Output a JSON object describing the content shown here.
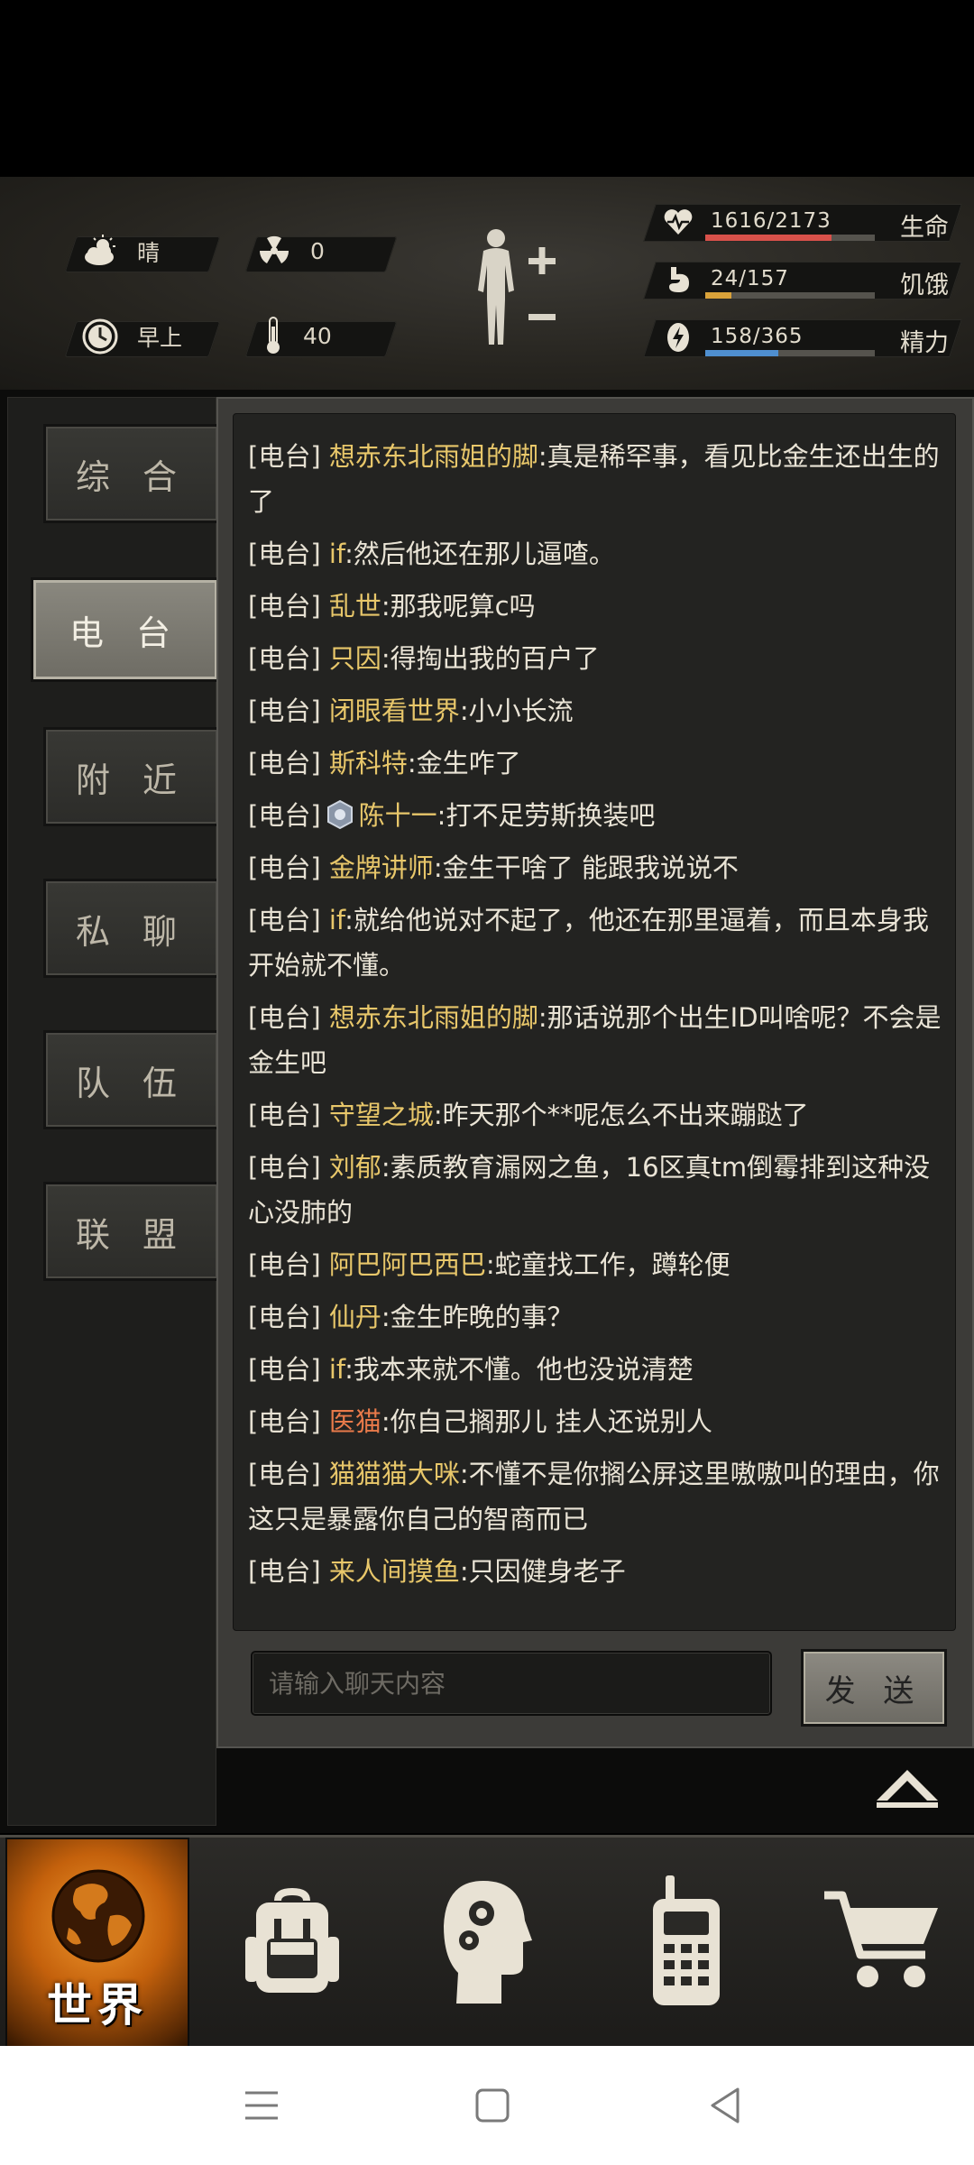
{
  "status": {
    "weather": "晴",
    "radiation": "0",
    "time_of_day": "早上",
    "temperature": "40",
    "stats": [
      {
        "label": "生命",
        "value": "1616/2173",
        "current": 1616,
        "max": 2173,
        "color": "#d8514a",
        "icon": "heart-icon"
      },
      {
        "label": "饥饿",
        "value": "24/157",
        "current": 24,
        "max": 157,
        "color": "#d9a23a",
        "icon": "stomach-icon"
      },
      {
        "label": "精力",
        "value": "158/365",
        "current": 158,
        "max": 365,
        "color": "#4f8fd0",
        "icon": "energy-icon"
      }
    ]
  },
  "tabs": [
    "综 合",
    "电 台",
    "附 近",
    "私 聊",
    "队 伍",
    "联 盟"
  ],
  "active_tab": 1,
  "messages": [
    {
      "tag": "[电台]",
      "name": "想赤东北雨姐的脚",
      "text": ":真是稀罕事，看见比金生还出生的了"
    },
    {
      "tag": "[电台]",
      "name": "if",
      "text": ":然后他还在那儿逼喳。"
    },
    {
      "tag": "[电台]",
      "name": "乱世",
      "text": ":那我呢算c吗"
    },
    {
      "tag": "[电台]",
      "name": "只因",
      "text": ":得掏出我的百户了"
    },
    {
      "tag": "[电台]",
      "name": "闭眼看世界",
      "text": ":小小长流"
    },
    {
      "tag": "[电台]",
      "name": "斯科特",
      "text": ":金生咋了"
    },
    {
      "tag": "[电台]",
      "name": "陈十一",
      "text": ":打不足劳斯换装吧",
      "badge": true
    },
    {
      "tag": "[电台]",
      "name": "金牌讲师",
      "text": ":金生干啥了 能跟我说说不"
    },
    {
      "tag": "[电台]",
      "name": "if",
      "text": ":就给他说对不起了，他还在那里逼着，而且本身我开始就不懂。"
    },
    {
      "tag": "[电台]",
      "name": "想赤东北雨姐的脚",
      "text": ":那话说那个出生ID叫啥呢？不会是金生吧"
    },
    {
      "tag": "[电台]",
      "name": "守望之城",
      "text": ":昨天那个**呢怎么不出来蹦跶了"
    },
    {
      "tag": "[电台]",
      "name": "刘郁",
      "text": ":素质教育漏网之鱼，16区真tm倒霉排到这种没心没肺的"
    },
    {
      "tag": "[电台]",
      "name": "阿巴阿巴西巴",
      "text": ":蛇童找工作，蹲轮便"
    },
    {
      "tag": "[电台]",
      "name": "仙丹",
      "text": ":金生昨晚的事？"
    },
    {
      "tag": "[电台]",
      "name": "if",
      "text": ":我本来就不懂。他也没说清楚"
    },
    {
      "tag": "[电台]",
      "name": "医猫",
      "text": ":你自己搁那儿 挂人还说别人",
      "red": true
    },
    {
      "tag": "[电台]",
      "name": "猫猫猫大咪",
      "text": ":不懂不是你搁公屏这里嗷嗷叫的理由，你这只是暴露你自己的智商而已"
    },
    {
      "tag": "[电台]",
      "name": "来人间摸鱼",
      "text": ":只因健身老子"
    }
  ],
  "input": {
    "placeholder": "请输入聊天内容",
    "value": ""
  },
  "send_label": "发 送",
  "nav": {
    "world_label": "世界"
  }
}
